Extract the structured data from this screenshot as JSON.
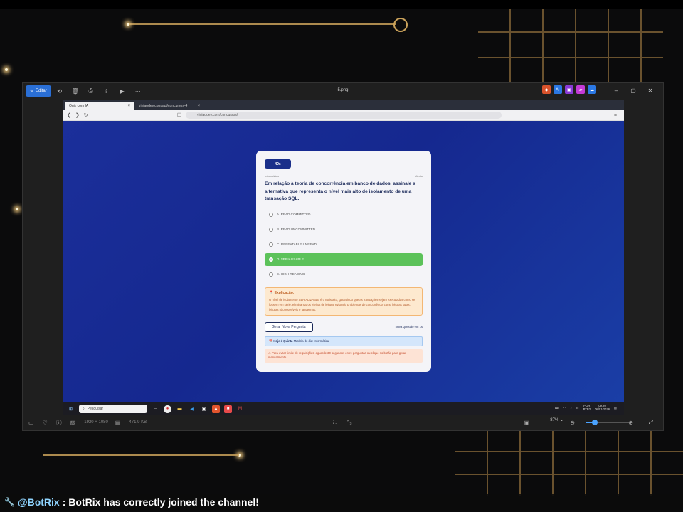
{
  "viewer": {
    "edit_label": "Editar",
    "file_title": "5.png",
    "more_label": "···",
    "dimensions": "1920 × 1080",
    "filesize": "471,9 KB",
    "zoom": "87%"
  },
  "browser": {
    "tabs": [
      {
        "label": "Quiz com IA"
      },
      {
        "label": "viniaodev.com/api/concursos-4"
      }
    ],
    "url": "viniaodev.com/concursos/"
  },
  "quiz": {
    "timer": "40s",
    "subject": "Informática",
    "difficulty": "Médio",
    "question": "Em relação à teoria de concorrência em banco de dados, assinale a alternativa que representa o nível mais alto de isolamento de uma transação SQL.",
    "options": [
      {
        "label": "A. READ COMMITTED",
        "state": "default"
      },
      {
        "label": "B. READ UNCOMMITTED",
        "state": "default"
      },
      {
        "label": "C. REPEATABLE UNREAD",
        "state": "default"
      },
      {
        "label": "D. SERIALIZABLE",
        "state": "correct"
      },
      {
        "label": "E. HIGH READING",
        "state": "default"
      }
    ],
    "explanation_title": "Explicação:",
    "explanation_text": "O nível de isolamento SERIALIZABLE é o mais alto, garantindo que as transações sejam executadas como se fossem em série, eliminando os efeitos de leitura, evitando problemas de concorrência como leituras sujas, leituras não repetíveis e fantasmas.",
    "new_question_button": "Gerar Nova Pergunta",
    "new_question_timer": "Nova questão em 1s",
    "today_label": "Hoje é Quinta",
    "today_detail": "Matéria do dia: Informática",
    "warning": "Para evitar limite de requisições, aguarde 30 segundos entre perguntas ou clique no botão para gerar manualmente."
  },
  "taskbar": {
    "search_placeholder": "Pesquisar",
    "lang": "POR",
    "lang2": "PTB2",
    "time": "09:20",
    "date": "08/01/2026"
  },
  "chat": {
    "user": "@BotRix",
    "message": ": BotRix has correctly joined the channel!"
  },
  "colors": {
    "accent": "#1a2f8a",
    "correct": "#5cc25a",
    "page_bg": "#15288f",
    "chat_user": "#8fd4ff"
  }
}
